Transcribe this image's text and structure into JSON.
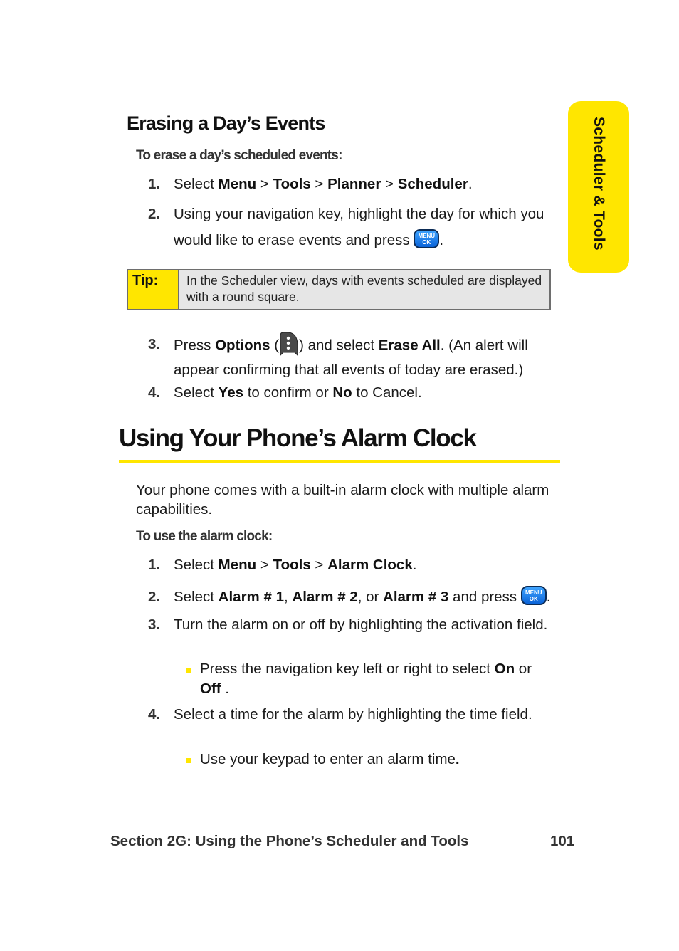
{
  "side_tab": {
    "label": "Scheduler & Tools",
    "color": "#ffe600"
  },
  "section1": {
    "heading": "Erasing a Day’s Events",
    "lead": "To erase a day’s scheduled events:",
    "steps": [
      {
        "num": "1.",
        "parts": [
          "Select ",
          "Menu",
          " > ",
          "Tools",
          " > ",
          "Planner",
          " > ",
          "Scheduler",
          "."
        ]
      },
      {
        "num": "2.",
        "text": "Using your navigation key, highlight the day for which you would like to erase events and press",
        "end": "."
      },
      {
        "num": "3.",
        "pre": "Press ",
        "options": "Options",
        "open": " (",
        "close": ") and select ",
        "erase_all": "Erase All",
        "post": ". (An alert will appear confirming that all events of today are erased.)"
      },
      {
        "num": "4.",
        "pre": "Select ",
        "yes": "Yes",
        "mid": " to confirm or ",
        "no": "No",
        "post": " to Cancel."
      }
    ],
    "tip": {
      "label": "Tip:",
      "text": "In the Scheduler view, days with events scheduled are displayed with a round square."
    }
  },
  "section2": {
    "heading": "Using Your Phone’s Alarm Clock",
    "intro": "Your phone comes with a built-in alarm clock with multiple alarm capabilities.",
    "lead": "To use the alarm clock:",
    "steps": [
      {
        "num": "1.",
        "pre": "Select ",
        "b1": "Menu",
        "s1": " > ",
        "b2": "Tools",
        "s2": " > ",
        "b3": "Alarm Clock",
        "end": "."
      },
      {
        "num": "2.",
        "pre": "Select ",
        "b1": "Alarm # 1",
        "s1": ", ",
        "b2": "Alarm # 2",
        "s2": ", or ",
        "b3": "Alarm # 3",
        "post": " and press",
        "end": "."
      },
      {
        "num": "3.",
        "text": "Turn the alarm on or off by highlighting the activation field.",
        "bullet": {
          "pre": "Press the navigation key left or right to select ",
          "on": "On",
          "mid": " or ",
          "off": "Off",
          "post": " ."
        }
      },
      {
        "num": "4.",
        "text": "Select a time for the alarm by highlighting the time field.",
        "bullet": {
          "text": "Use your keypad to enter an alarm time",
          "end": "."
        }
      }
    ]
  },
  "icons": {
    "menu_ok_top": "MENU",
    "menu_ok_bottom": "OK"
  },
  "footer": {
    "section": "Section 2G: Using the Phone’s Scheduler and Tools",
    "page": "101"
  }
}
